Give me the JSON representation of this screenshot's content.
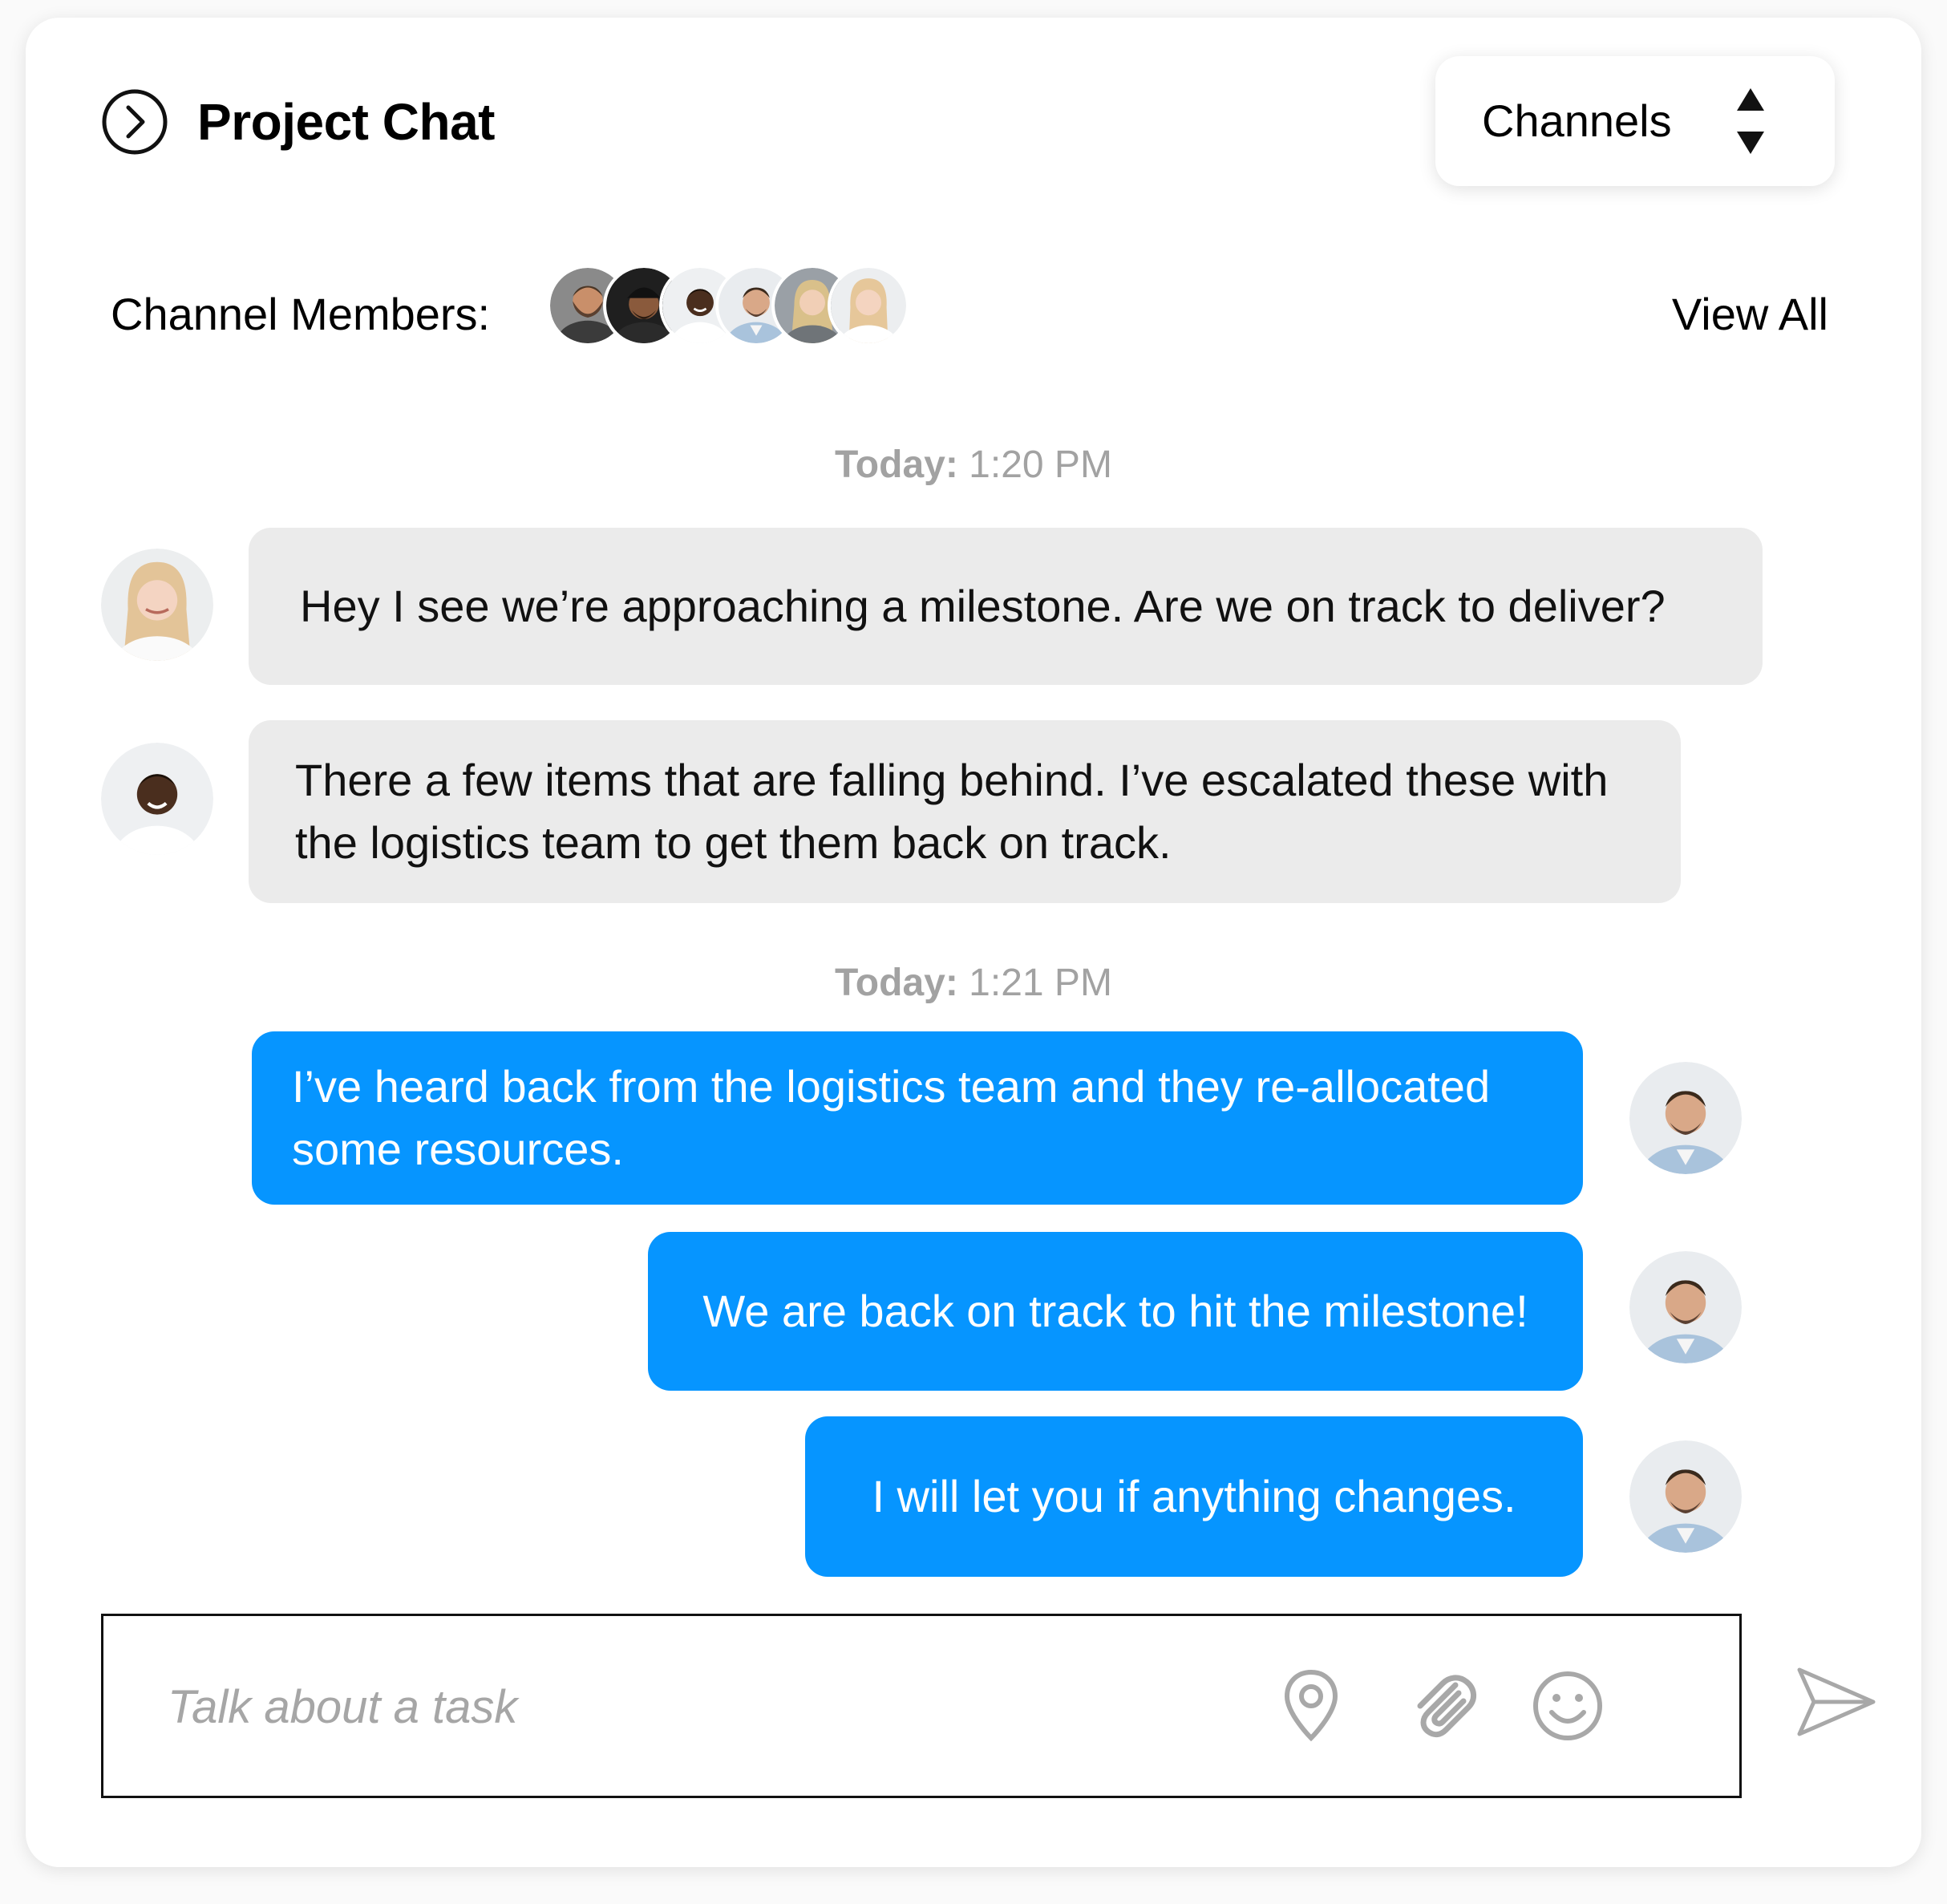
{
  "header": {
    "title": "Project Chat",
    "toggle_icon": "chevron-right-circle-icon",
    "channels_label": "Channels",
    "channels_icon": "sort-arrows-icon"
  },
  "members": {
    "label": "Channel Members:",
    "view_all": "View All",
    "avatars": [
      "man-beard-avatar",
      "man-cap-avatar",
      "man-smile-avatar",
      "man-shirt-avatar",
      "woman-blonde-avatar",
      "woman-fair-avatar"
    ]
  },
  "messages": {
    "stamp1": {
      "prefix": "Today:",
      "time": "1:20 PM"
    },
    "stamp2": {
      "prefix": "Today:",
      "time": "1:21 PM"
    },
    "m1": {
      "sender": "incoming",
      "avatar": "woman-blonde-avatar",
      "text": "Hey I see we’re approaching a milestone. Are we on track to deliver?"
    },
    "m2": {
      "sender": "incoming",
      "avatar": "man-smile-avatar",
      "text": "There a few items that are falling behind. I’ve escalated these with the logistics team to get them back on track."
    },
    "m3": {
      "sender": "outgoing",
      "avatar": "man-shirt-avatar",
      "text": "I’ve heard back from the logistics team and they re-allocated some resources."
    },
    "m4": {
      "sender": "outgoing",
      "avatar": "man-shirt-avatar",
      "text": "We are back on track to hit the milestone!"
    },
    "m5": {
      "sender": "outgoing",
      "avatar": "man-shirt-avatar",
      "text": "I will let you if anything changes."
    }
  },
  "composer": {
    "placeholder": "Talk about a task",
    "value": "",
    "icons": [
      "location-pin-icon",
      "paperclip-icon",
      "smiley-icon",
      "send-icon"
    ]
  },
  "colors": {
    "outgoing_bubble": "#0695ff",
    "incoming_bubble": "#ebebeb",
    "timestamp": "#a2a2a2",
    "icon_gray": "#a8a8a8"
  }
}
